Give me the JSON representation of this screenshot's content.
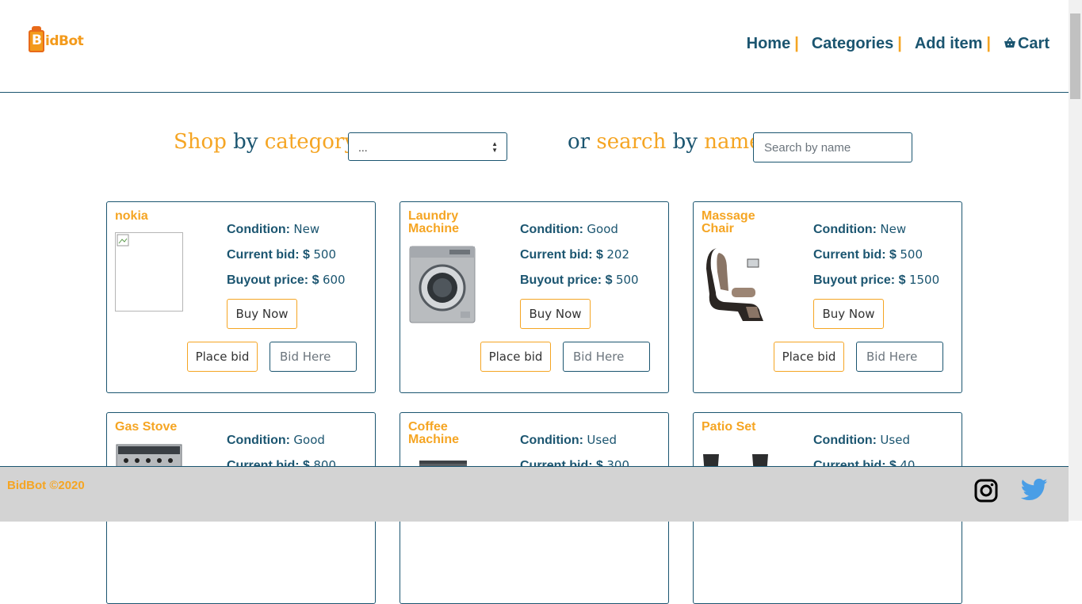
{
  "brand": {
    "logo_letter": "B",
    "logo_text": "idBot"
  },
  "nav": {
    "home": "Home",
    "categories": "Categories",
    "add_item": "Add item",
    "cart": "Cart",
    "separator": "|"
  },
  "search_bar": {
    "shop": "Shop",
    "by": "by",
    "category": "category",
    "or": "or",
    "search": "search",
    "name": "name",
    "category_selected": "...",
    "search_placeholder": "Search by name"
  },
  "labels": {
    "condition": "Condition:",
    "current_bid": "Current bid:",
    "buyout": "Buyout price:",
    "currency": "$",
    "buy_now": "Buy Now",
    "place_bid": "Place bid",
    "bid_placeholder": "Bid Here"
  },
  "items": [
    {
      "name": "nokia",
      "condition": "New",
      "current_bid": "500",
      "buyout": "600"
    },
    {
      "name": "Laundry Machine",
      "condition": "Good",
      "current_bid": "202",
      "buyout": "500"
    },
    {
      "name": "Massage Chair",
      "condition": "New",
      "current_bid": "500",
      "buyout": "1500"
    },
    {
      "name": "Gas Stove",
      "condition": "Good",
      "current_bid": "800"
    },
    {
      "name": "Coffee Machine",
      "condition": "Used",
      "current_bid": "300"
    },
    {
      "name": "Patio Set",
      "condition": "Used",
      "current_bid": "40"
    }
  ],
  "footer": {
    "copyright": "BidBot ©2020"
  },
  "colors": {
    "primary": "#1b5570",
    "accent": "#f5a523",
    "footer_bg": "#d3d3d3",
    "twitter": "#1da1f2"
  },
  "icons": {
    "cart": "basket-icon",
    "instagram": "instagram-icon",
    "twitter": "twitter-icon"
  }
}
